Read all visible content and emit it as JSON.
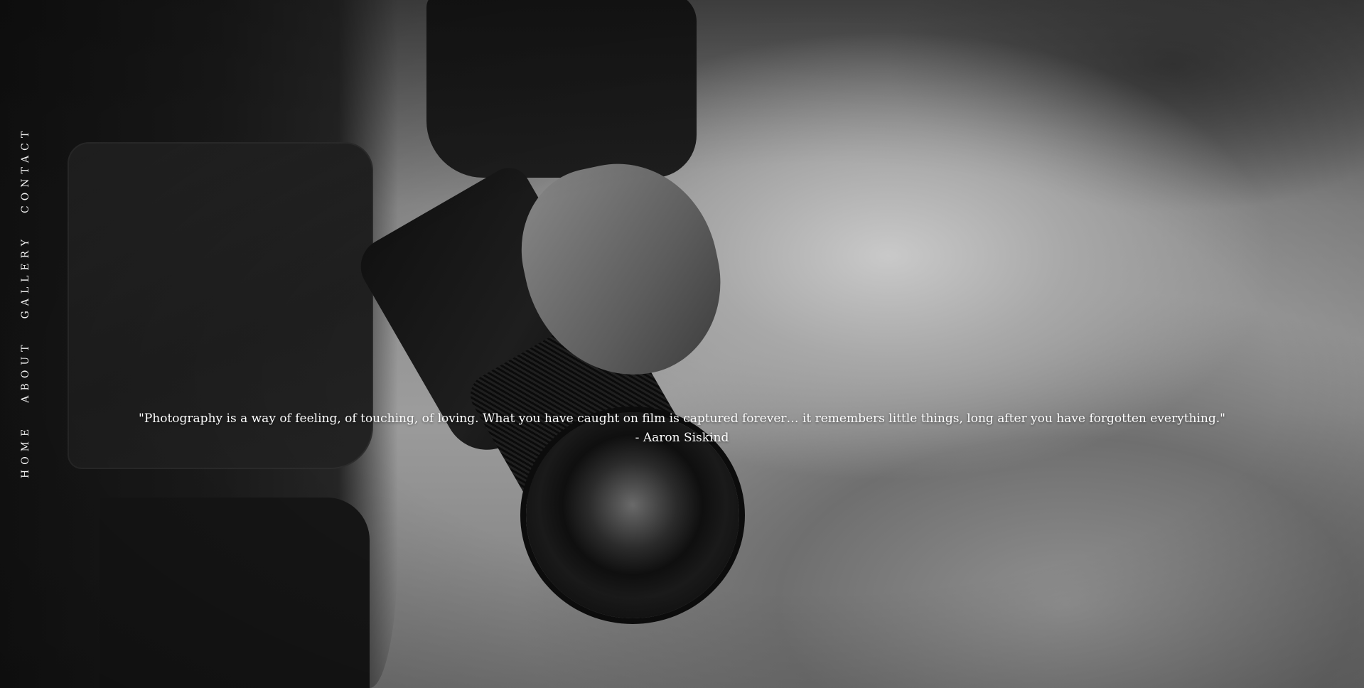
{
  "nav": {
    "items": [
      {
        "label": "HOME"
      },
      {
        "label": "ABOUT"
      },
      {
        "label": "GALLERY"
      },
      {
        "label": "CONTACT"
      }
    ]
  },
  "hero": {
    "quote": "\"Photography is a way of feeling, of touching, of loving. What you have caught on film is captured forever… it remembers little things, long after you have forgotten everything.\"",
    "author": "- Aaron Siskind"
  }
}
